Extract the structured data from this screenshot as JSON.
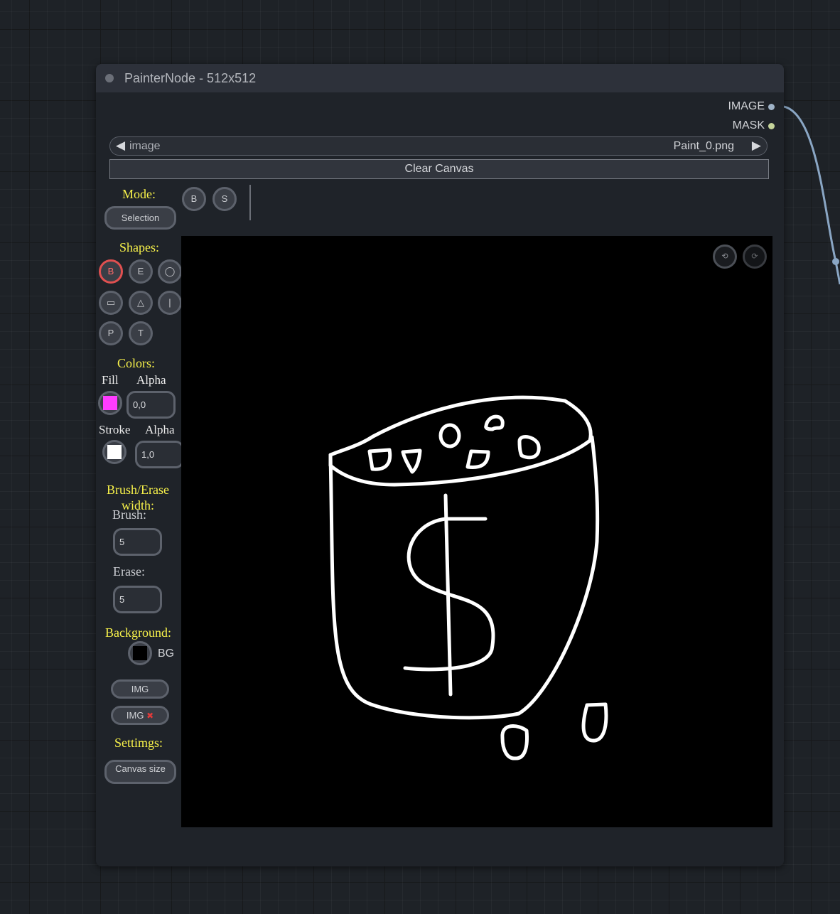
{
  "node": {
    "title": "PainterNode - 512x512",
    "outputs": [
      {
        "label": "IMAGE",
        "color": "#9fb3c8"
      },
      {
        "label": "MASK",
        "color": "#c5d49a"
      }
    ]
  },
  "image_combo": {
    "name": "image",
    "value": "Paint_0.png"
  },
  "clear_canvas_label": "Clear Canvas",
  "toolbar": {
    "mode_label": "Mode:",
    "selection_label": "Selection",
    "top_buttons": [
      "B",
      "S"
    ],
    "shapes_label": "Shapes:",
    "shapes": [
      {
        "key": "B",
        "glyph": "B",
        "active": true
      },
      {
        "key": "E",
        "glyph": "E",
        "active": false
      },
      {
        "key": "circle",
        "glyph": "◯",
        "active": false
      },
      {
        "key": "rect",
        "glyph": "▭",
        "active": false
      },
      {
        "key": "triangle",
        "glyph": "△",
        "active": false
      },
      {
        "key": "line",
        "glyph": "|",
        "active": false
      },
      {
        "key": "P",
        "glyph": "P",
        "active": false
      },
      {
        "key": "T",
        "glyph": "T",
        "active": false
      }
    ],
    "colors_label": "Colors:",
    "fill_label": "Fill",
    "fill_alpha_label": "Alpha",
    "fill_color": "#ff3cff",
    "fill_alpha_value": "0,0",
    "stroke_label": "Stroke",
    "stroke_alpha_label": "Alpha",
    "stroke_color": "#ffffff",
    "stroke_alpha_value": "1,0",
    "brush_erase_label": "Brush/Erase width:",
    "brush_label": "Brush:",
    "brush_value": "5",
    "erase_label": "Erase:",
    "erase_value": "5",
    "background_label": "Background:",
    "bg_color": "#000000",
    "bg_label": "BG",
    "img_label": "IMG",
    "img_remove_label": "IMG",
    "img_remove_icon": "✖",
    "settings_label": "Settimgs:",
    "canvas_size_label": "Canvas size"
  },
  "canvas": {
    "background": "#000000",
    "stroke_color": "#ffffff",
    "undo_glyph": "⟲",
    "redo_glyph": "⟳"
  }
}
